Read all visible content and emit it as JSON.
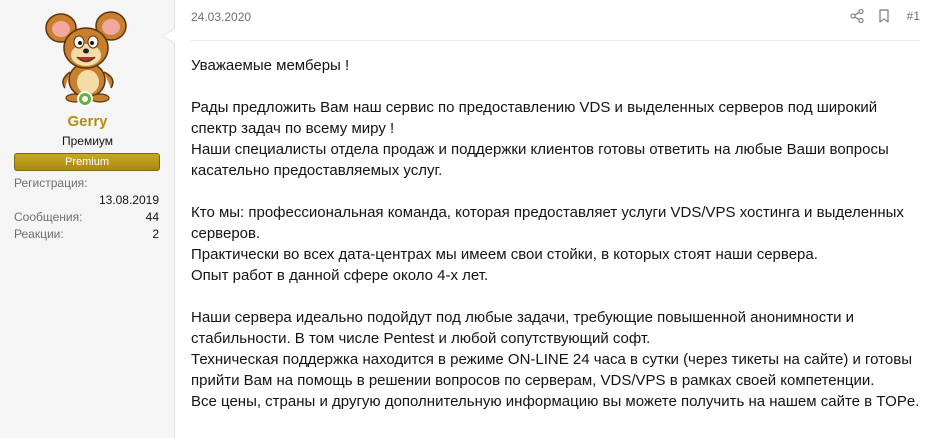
{
  "user": {
    "name": "Gerry",
    "title": "Премиум",
    "banner": "Premium",
    "avatar_icon": "jerry-mouse-avatar",
    "online_icon": "online-status-icon",
    "stats": [
      {
        "label": "Регистрация:",
        "value": "13.08.2019"
      },
      {
        "label": "Сообщения:",
        "value": "44"
      },
      {
        "label": "Реакции:",
        "value": "2"
      }
    ]
  },
  "post": {
    "date": "24.03.2020",
    "number": "#1",
    "share_icon": "share-icon",
    "bookmark_icon": "bookmark-icon",
    "lines": {
      "l1": "Уважаемые мемберы !",
      "l2": "Рады предложить Вам наш сервис по предоставлению VDS и выделенных серверов под широкий",
      "l3": "спектр задач по всему миру !",
      "l4": "Наши специалисты отдела продаж и поддержки клиентов готовы ответить на любые Ваши вопросы",
      "l5": "касательно предоставляемых услуг.",
      "l6": "Кто мы: профессиональная команда, которая предоставляет услуги VDS/VPS хостинга и выделенных",
      "l7": "серверов.",
      "l8": "Практически во всех дата-центрах мы имеем свои стойки, в которых стоят наши сервера.",
      "l9": "Опыт работ в данной сфере около 4-х лет.",
      "l10": "Наши сервера идеально подойдут под любые задачи, требующие повышенной анонимности и",
      "l11": "стабильности. В том числе Pentest и любой сопутствующий софт.",
      "l12": "Техническая поддержка находится в режиме ON-LINE 24 часа в сутки (через тикеты на сайте) и готовы",
      "l13": "прийти Вам на помощь в решении вопросов по серверам, VDS/VPS в рамках своей компетенции.",
      "l14": "Все цены, страны и другую дополнительную информацию вы можете получить на нашем сайте в TOPе."
    }
  },
  "colors": {
    "username": "#b08d14",
    "banner": "#b8991c",
    "online": "#63b233"
  }
}
